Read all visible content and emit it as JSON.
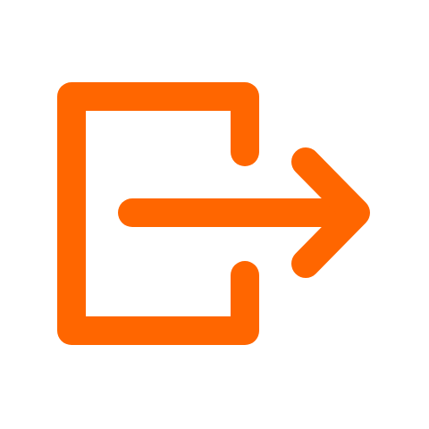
{
  "icon": {
    "name": "logout-icon",
    "color": "#ff6600",
    "background": "#ffffff"
  }
}
